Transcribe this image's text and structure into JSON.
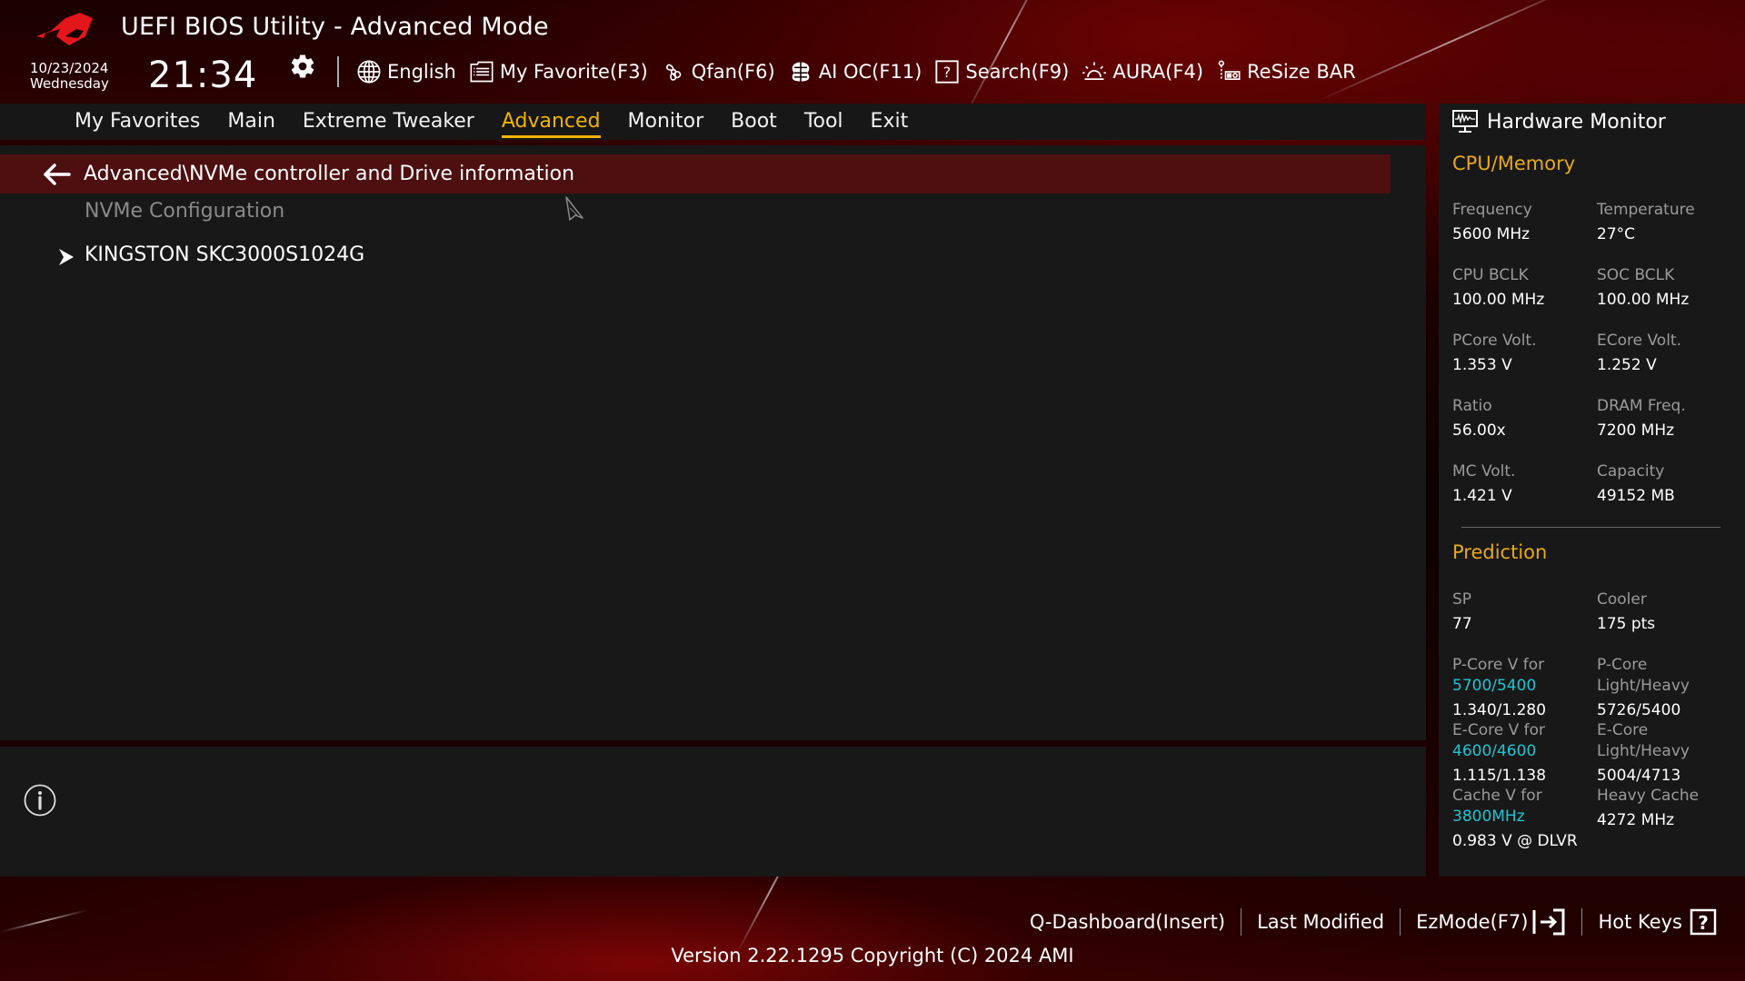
{
  "header": {
    "title": "UEFI BIOS Utility - Advanced Mode",
    "date": "10/23/2024",
    "weekday": "Wednesday",
    "time": "21:34",
    "toolbar": [
      {
        "icon": "globe-icon",
        "label": "English"
      },
      {
        "icon": "favorite-list-icon",
        "label": "My Favorite(F3)"
      },
      {
        "icon": "fan-icon",
        "label": "Qfan(F6)"
      },
      {
        "icon": "ai-chip-icon",
        "label": "AI OC(F11)"
      },
      {
        "icon": "search-question-icon",
        "label": "Search(F9)"
      },
      {
        "icon": "aura-light-icon",
        "label": "AURA(F4)"
      },
      {
        "icon": "resize-bar-icon",
        "label": "ReSize BAR"
      }
    ]
  },
  "tabs": [
    {
      "label": "My Favorites",
      "active": false
    },
    {
      "label": "Main",
      "active": false
    },
    {
      "label": "Extreme Tweaker",
      "active": false
    },
    {
      "label": "Advanced",
      "active": true
    },
    {
      "label": "Monitor",
      "active": false
    },
    {
      "label": "Boot",
      "active": false
    },
    {
      "label": "Tool",
      "active": false
    },
    {
      "label": "Exit",
      "active": false
    }
  ],
  "main": {
    "path": "Advanced\\NVMe controller and Drive information",
    "items": [
      {
        "label": "NVMe Configuration",
        "type": "heading"
      },
      {
        "label": "KINGSTON SKC3000S1024G",
        "type": "submenu"
      }
    ]
  },
  "hardware_monitor": {
    "title": "Hardware Monitor",
    "cpu_memory": {
      "heading": "CPU/Memory",
      "rows": [
        [
          {
            "label": "Frequency",
            "value": "5600 MHz"
          },
          {
            "label": "Temperature",
            "value": "27°C"
          }
        ],
        [
          {
            "label": "CPU BCLK",
            "value": "100.00 MHz"
          },
          {
            "label": "SOC BCLK",
            "value": "100.00 MHz"
          }
        ],
        [
          {
            "label": "PCore Volt.",
            "value": "1.353 V"
          },
          {
            "label": "ECore Volt.",
            "value": "1.252 V"
          }
        ],
        [
          {
            "label": "Ratio",
            "value": "56.00x"
          },
          {
            "label": "DRAM Freq.",
            "value": "7200 MHz"
          }
        ],
        [
          {
            "label": "MC Volt.",
            "value": "1.421 V"
          },
          {
            "label": "Capacity",
            "value": "49152 MB"
          }
        ]
      ]
    },
    "prediction": {
      "heading": "Prediction",
      "sp": {
        "label": "SP",
        "value": "77"
      },
      "cooler": {
        "label": "Cooler",
        "value": "175 pts"
      },
      "pcore_v": {
        "label": "P-Core V for",
        "freq": "5700/5400",
        "value": "1.340/1.280"
      },
      "pcore_lh": {
        "label1": "P-Core",
        "label2": "Light/Heavy",
        "value": "5726/5400"
      },
      "ecore_v": {
        "label": "E-Core V for",
        "freq": "4600/4600",
        "value": "1.115/1.138"
      },
      "ecore_lh": {
        "label1": "E-Core",
        "label2": "Light/Heavy",
        "value": "5004/4713"
      },
      "cache_v": {
        "label": "Cache V for",
        "freq": "3800MHz",
        "value": "0.983 V @ DLVR"
      },
      "heavy_cache": {
        "label": "Heavy Cache",
        "value": "4272 MHz"
      }
    }
  },
  "footer": {
    "links": [
      {
        "label": "Q-Dashboard(Insert)"
      },
      {
        "label": "Last Modified"
      },
      {
        "label": "EzMode(F7)"
      },
      {
        "label": "Hot Keys"
      }
    ],
    "version": "Version 2.22.1295 Copyright (C) 2024 AMI"
  },
  "colors": {
    "accent_yellow": "#f0b400",
    "highlight_row": "#4d0f10",
    "prediction_cyan": "#1fc4d2",
    "panel_bg": "#181818"
  }
}
